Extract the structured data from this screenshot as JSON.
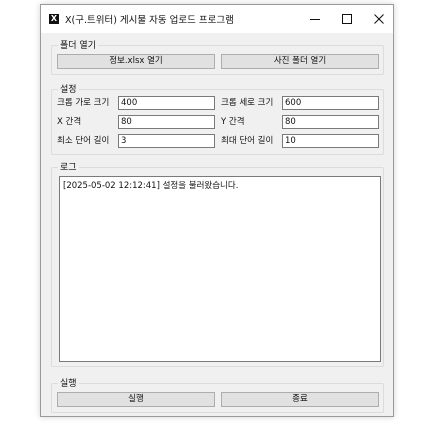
{
  "window": {
    "title": "X(구.트위터) 게시물 자동 업로드 프로그램",
    "icon": "X"
  },
  "folder_group": {
    "label": "폴더 열기",
    "open_info_button": "정보.xlsx 열기",
    "open_photo_button": "사진 폴더 열기"
  },
  "settings_group": {
    "label": "설정",
    "crop_width_label": "크롭 가로 크기",
    "crop_width_value": "400",
    "crop_height_label": "크롭 세로 크기",
    "crop_height_value": "600",
    "x_gap_label": "X 간격",
    "x_gap_value": "80",
    "y_gap_label": "Y 간격",
    "y_gap_value": "80",
    "min_word_label": "최소 단어 길이",
    "min_word_value": "3",
    "max_word_label": "최대 단어 길이",
    "max_word_value": "10"
  },
  "log_group": {
    "label": "로그",
    "lines": [
      "[2025-05-02 12:12:41] 설정을 불러왔습니다."
    ]
  },
  "run_group": {
    "label": "실행",
    "run_button": "실행",
    "exit_button": "종료"
  }
}
